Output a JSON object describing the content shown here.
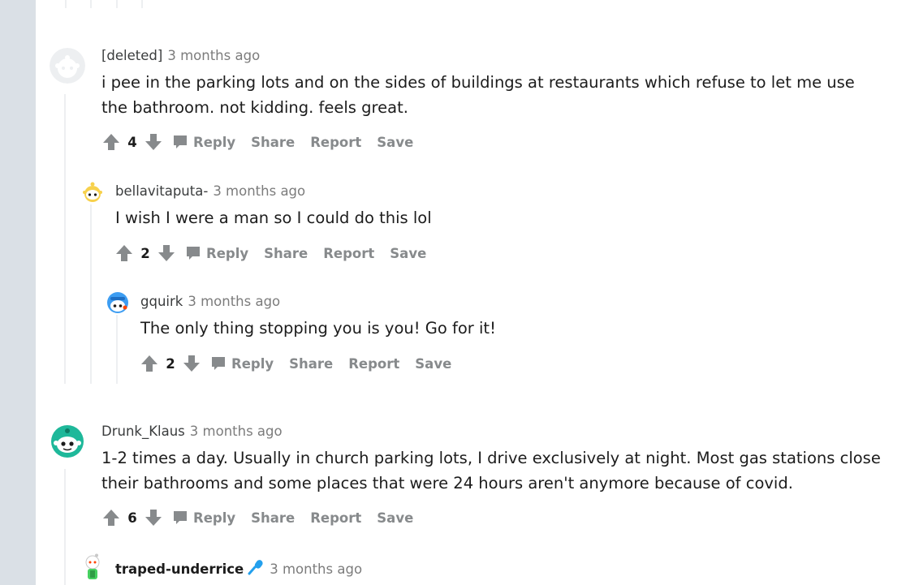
{
  "comments": [
    {
      "author": "[deleted]",
      "time": "3 months ago",
      "avatar_icon": "deleted-snoo-icon",
      "body": "i pee in the parking lots and on the sides of buildings at restaurants which refuse to let me use the bathroom. not kidding. feels great.",
      "score": "4",
      "actions": [
        "Reply",
        "Share",
        "Report",
        "Save"
      ]
    },
    {
      "author": "bellavitaputa-",
      "time": "3 months ago",
      "avatar_icon": "yellow-snoo-icon",
      "body": "I wish I were a man so I could do this lol",
      "score": "2",
      "actions": [
        "Reply",
        "Share",
        "Report",
        "Save"
      ]
    },
    {
      "author": "gquirk",
      "time": "3 months ago",
      "avatar_icon": "blue-helmet-snoo-icon",
      "body": "The only thing stopping you is you! Go for it!",
      "score": "2",
      "actions": [
        "Reply",
        "Share",
        "Report",
        "Save"
      ]
    },
    {
      "author": "Drunk_Klaus",
      "time": "3 months ago",
      "avatar_icon": "teal-snoo-icon",
      "body": "1-2 times a day. Usually in church parking lots, I drive exclusively at night. Most gas stations close their bathrooms and some places that were 24 hours aren't anymore because of covid.",
      "score": "6",
      "actions": [
        "Reply",
        "Share",
        "Report",
        "Save"
      ]
    },
    {
      "author": "traped-underrice",
      "time": "3 months ago",
      "avatar_icon": "green-snoo-icon",
      "flair_icon": "microphone-icon"
    }
  ],
  "colors": {
    "thread_line": "#edeff1",
    "action_text": "#878a8c",
    "body_text": "#1c1c1c",
    "page_bg": "#dae0e6"
  }
}
